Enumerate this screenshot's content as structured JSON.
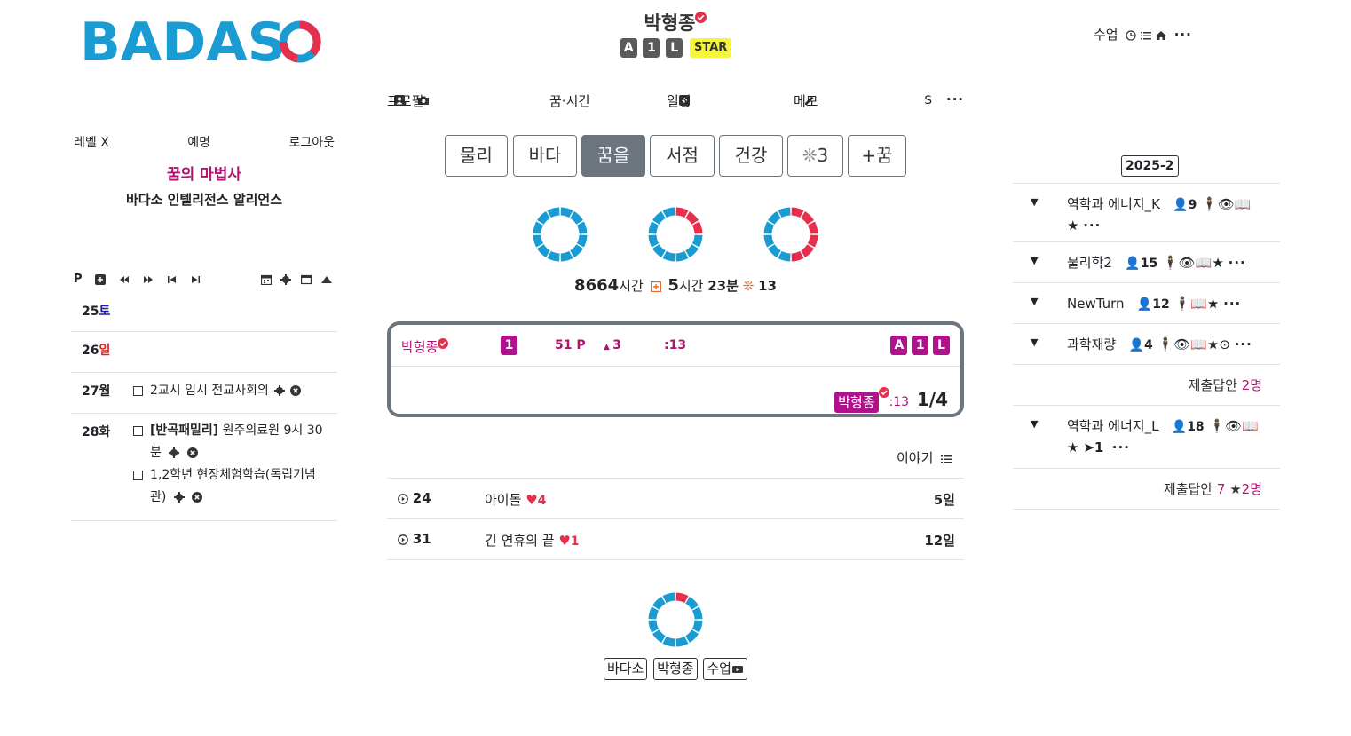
{
  "logo": {
    "text": "BADASO",
    "colors": {
      "primary": "#1a9bd1",
      "accent": "#e5304d"
    }
  },
  "header": {
    "username": "박형종",
    "badges": [
      "A",
      "1",
      "L"
    ],
    "star": "STAR"
  },
  "topnav": {
    "class_label": "수업"
  },
  "left": {
    "level": "레벨 X",
    "nickname": "예명",
    "logout": "로그아웃",
    "title": "꿈의 마법사",
    "alliance": "바다소 인텔리전스 알리언스",
    "toolbar_p": "P",
    "calendar": [
      {
        "day": "25",
        "weekday": "토",
        "items": []
      },
      {
        "day": "26",
        "weekday": "일",
        "items": []
      },
      {
        "day": "27",
        "weekday": "월",
        "items": [
          {
            "text": "2교시 임시 전교사회의"
          }
        ]
      },
      {
        "day": "28",
        "weekday": "화",
        "items": [
          {
            "bold": "[반곡패밀리]",
            "text": " 원주의료원 9시 30분"
          },
          {
            "bold": "",
            "text": "1,2학년 현장체험학습(독립기념관)"
          }
        ]
      }
    ]
  },
  "center": {
    "menu": {
      "profile": "프로필",
      "dream_time": "꿈·시간",
      "schedule": "일정",
      "memo": "메모",
      "dollar": "$"
    },
    "tabs": [
      "물리",
      "바다",
      "꿈을",
      "서점",
      "건강",
      "3",
      "+꿈"
    ],
    "active_tab": "꿈을",
    "stats": {
      "hours": "8664",
      "hours_unit": "시간",
      "today_hours": "5",
      "today_hours_unit": "시간",
      "today_min": "23분",
      "sparks": "13"
    },
    "feed": {
      "name": "박형종",
      "level": "1",
      "points": "51 P",
      "up": "3",
      "time": ":13",
      "badges": [
        "A",
        "1",
        "L"
      ],
      "reply_name": "박형종",
      "reply_time": ":13",
      "fraction": "1/4"
    },
    "stories_label": "이야기",
    "stories": [
      {
        "num": "24",
        "title": "아이돌",
        "hearts": "4",
        "age": "5일"
      },
      {
        "num": "31",
        "title": "긴 연휴의 끝",
        "hearts": "1",
        "age": "12일"
      }
    ],
    "bottom_buttons": [
      "바다소",
      "박형종",
      "수업"
    ]
  },
  "right": {
    "semester": "2025-2",
    "courses": [
      {
        "name": "역학과 에너지_K",
        "students": "9"
      },
      {
        "name": "물리학2",
        "students": "15"
      },
      {
        "name": "NewTurn",
        "students": "12"
      },
      {
        "name": "과학재량",
        "students": "4"
      }
    ],
    "submit1": {
      "label": "제출답안",
      "count": "2명"
    },
    "course5": {
      "name": "역학과 에너지_L",
      "students": "18",
      "arrow": "1"
    },
    "submit2": {
      "label": "제출답안",
      "count": "7",
      "stars": "2명"
    }
  },
  "donut_levels": [
    0,
    0.25,
    0.5,
    0.08
  ],
  "colors": {
    "blue": "#1a9bd1",
    "red": "#e5304d",
    "pink": "#b0126f",
    "gray": "#6c757d"
  }
}
